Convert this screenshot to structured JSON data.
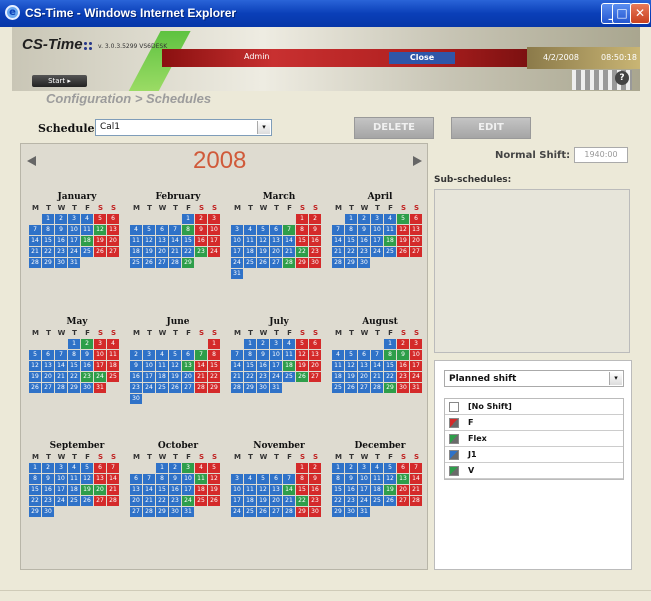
{
  "window": {
    "title": "CS-Time - Windows Internet Explorer",
    "ie_icon": "e",
    "min": "_",
    "max": "□",
    "close": "✕"
  },
  "header": {
    "logo": "CS-Time",
    "version": "v. 3.0.3.5299 VS6DESK",
    "user": "Admin",
    "close_label": "Close",
    "date": "4/2/2008",
    "time": "08:50:18",
    "help": "?",
    "start_label": "Start ▸"
  },
  "breadcrumb": "Configuration > Schedules",
  "schedule": {
    "label": "Schedule:",
    "value": "Cal1"
  },
  "buttons": {
    "delete": "DELETE",
    "edit": "EDIT"
  },
  "calendar": {
    "year": "2008",
    "weekday_headers": [
      "M",
      "T",
      "W",
      "T",
      "F",
      "S",
      "S"
    ],
    "months": [
      {
        "name": "January",
        "offset": 1,
        "days": 31
      },
      {
        "name": "February",
        "offset": 4,
        "days": 29
      },
      {
        "name": "March",
        "offset": 5,
        "days": 31
      },
      {
        "name": "April",
        "offset": 1,
        "days": 30
      },
      {
        "name": "May",
        "offset": 3,
        "days": 31
      },
      {
        "name": "June",
        "offset": 6,
        "days": 30
      },
      {
        "name": "July",
        "offset": 1,
        "days": 31
      },
      {
        "name": "August",
        "offset": 4,
        "days": 31
      },
      {
        "name": "September",
        "offset": 0,
        "days": 30
      },
      {
        "name": "October",
        "offset": 2,
        "days": 31
      },
      {
        "name": "November",
        "offset": 5,
        "days": 30
      },
      {
        "name": "December",
        "offset": 0,
        "days": 31
      }
    ]
  },
  "normal_shift": {
    "label": "Normal Shift:",
    "value": "1940:00"
  },
  "subschedules": {
    "label": "Sub-schedules:"
  },
  "planned": {
    "select_value": "Planned shift",
    "shifts": [
      {
        "label": "[No Shift]",
        "color": "#ffffff"
      },
      {
        "label": "F",
        "color": "#d42a2a"
      },
      {
        "label": "Flex",
        "color": "#2e9e4a"
      },
      {
        "label": "J1",
        "color": "#2f72c8"
      },
      {
        "label": "V",
        "color": "#2e9e4a"
      }
    ]
  },
  "colors": {
    "workday": "#2f72c8",
    "weekend": "#d42a2a",
    "green": "#2e9e4a"
  }
}
